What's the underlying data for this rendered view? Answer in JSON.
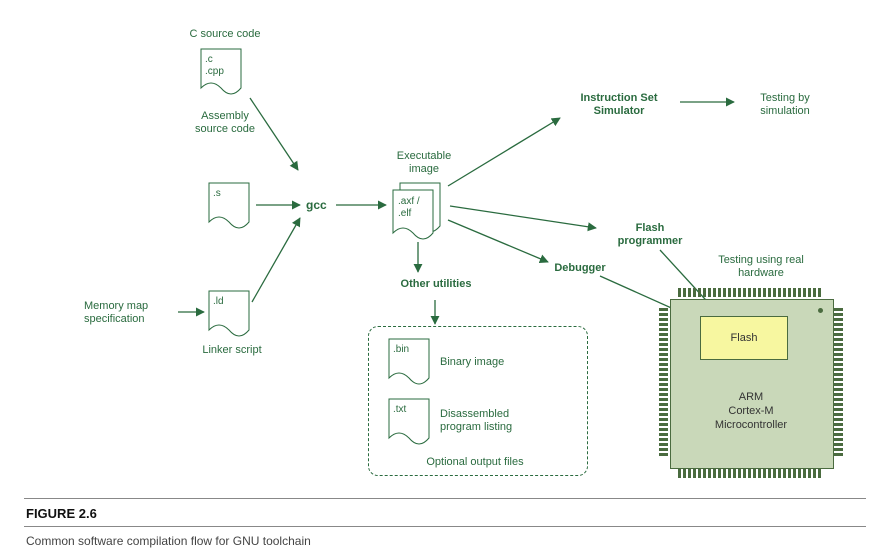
{
  "figure": {
    "number": "FIGURE 2.6",
    "caption": "Common software compilation flow for GNU toolchain"
  },
  "nodes": {
    "c_source": {
      "title": "C source code",
      "ext": ".c\n.cpp",
      "sub": "Assembly\nsource code"
    },
    "asm_source": {
      "ext": ".s"
    },
    "linker": {
      "ext": ".ld",
      "sub": "Linker script"
    },
    "memmap": {
      "label": "Memory map\nspecification"
    },
    "gcc": {
      "label": "gcc"
    },
    "exec": {
      "title": "Executable\nimage",
      "ext": ".axf /\n.elf"
    },
    "other_util": {
      "label": "Other utilities"
    },
    "bin": {
      "ext": ".bin",
      "desc": "Binary image"
    },
    "txt": {
      "ext": ".txt",
      "desc": "Disassembled\nprogram listing"
    },
    "opt_box": {
      "label": "Optional output files"
    },
    "iss": {
      "label": "Instruction Set\nSimulator"
    },
    "sim_test": {
      "label": "Testing by\nsimulation"
    },
    "flash_prog": {
      "label": "Flash\nprogrammer"
    },
    "debugger": {
      "label": "Debugger"
    },
    "hw_test": {
      "label": "Testing using real\nhardware"
    },
    "chip": {
      "flash": "Flash",
      "mcu": "ARM\nCortex-M\nMicrocontroller"
    }
  }
}
